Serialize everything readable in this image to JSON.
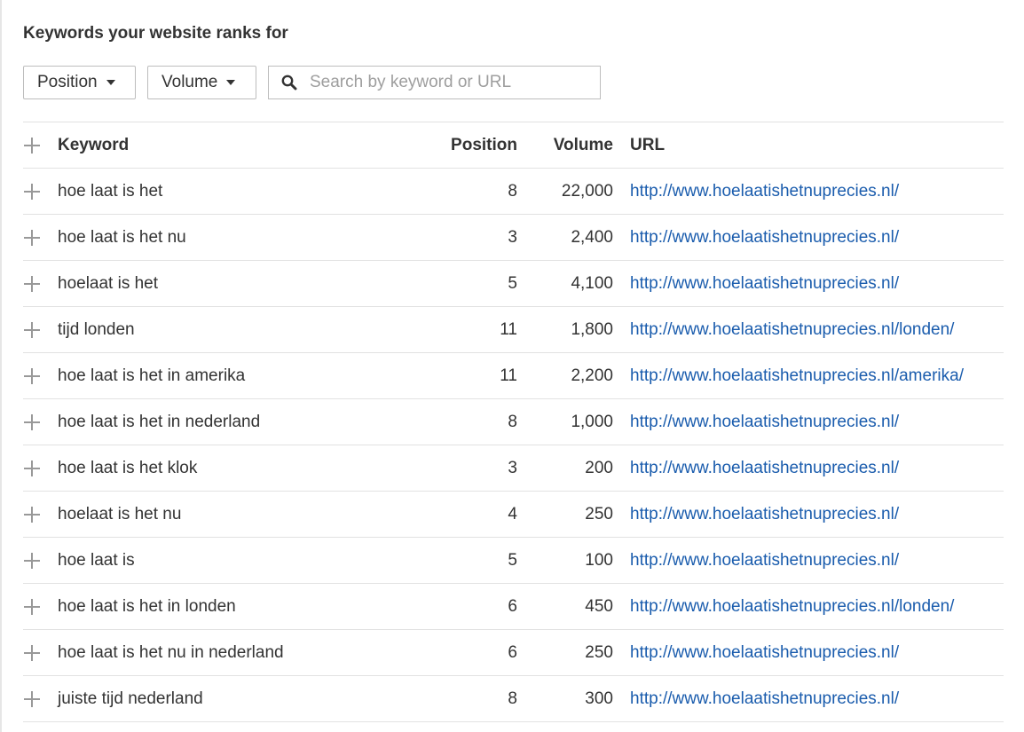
{
  "title": "Keywords your website ranks for",
  "filters": {
    "position_label": "Position",
    "volume_label": "Volume",
    "search_placeholder": "Search by keyword or URL"
  },
  "table": {
    "columns": [
      "Keyword",
      "Position",
      "Volume",
      "URL"
    ],
    "rows": [
      {
        "keyword": "hoe laat is het",
        "position": "8",
        "volume": "22,000",
        "url": "http://www.hoelaatishetnuprecies.nl/"
      },
      {
        "keyword": "hoe laat is het nu",
        "position": "3",
        "volume": "2,400",
        "url": "http://www.hoelaatishetnuprecies.nl/"
      },
      {
        "keyword": "hoelaat is het",
        "position": "5",
        "volume": "4,100",
        "url": "http://www.hoelaatishetnuprecies.nl/"
      },
      {
        "keyword": "tijd londen",
        "position": "11",
        "volume": "1,800",
        "url": "http://www.hoelaatishetnuprecies.nl/londen/"
      },
      {
        "keyword": "hoe laat is het in amerika",
        "position": "11",
        "volume": "2,200",
        "url": "http://www.hoelaatishetnuprecies.nl/amerika/"
      },
      {
        "keyword": "hoe laat is het in nederland",
        "position": "8",
        "volume": "1,000",
        "url": "http://www.hoelaatishetnuprecies.nl/"
      },
      {
        "keyword": "hoe laat is het klok",
        "position": "3",
        "volume": "200",
        "url": "http://www.hoelaatishetnuprecies.nl/"
      },
      {
        "keyword": "hoelaat is het nu",
        "position": "4",
        "volume": "250",
        "url": "http://www.hoelaatishetnuprecies.nl/"
      },
      {
        "keyword": "hoe laat is",
        "position": "5",
        "volume": "100",
        "url": "http://www.hoelaatishetnuprecies.nl/"
      },
      {
        "keyword": "hoe laat is het in londen",
        "position": "6",
        "volume": "450",
        "url": "http://www.hoelaatishetnuprecies.nl/londen/"
      },
      {
        "keyword": "hoe laat is het nu in nederland",
        "position": "6",
        "volume": "250",
        "url": "http://www.hoelaatishetnuprecies.nl/"
      },
      {
        "keyword": "juiste tijd nederland",
        "position": "8",
        "volume": "300",
        "url": "http://www.hoelaatishetnuprecies.nl/"
      }
    ]
  },
  "icons": {
    "expand": "plus-icon",
    "dropdown": "caret-down-icon",
    "search": "search-icon"
  },
  "colors": {
    "link": "#1a5cad",
    "text": "#333333",
    "border": "#e2e2e2",
    "icon": "#999999"
  }
}
